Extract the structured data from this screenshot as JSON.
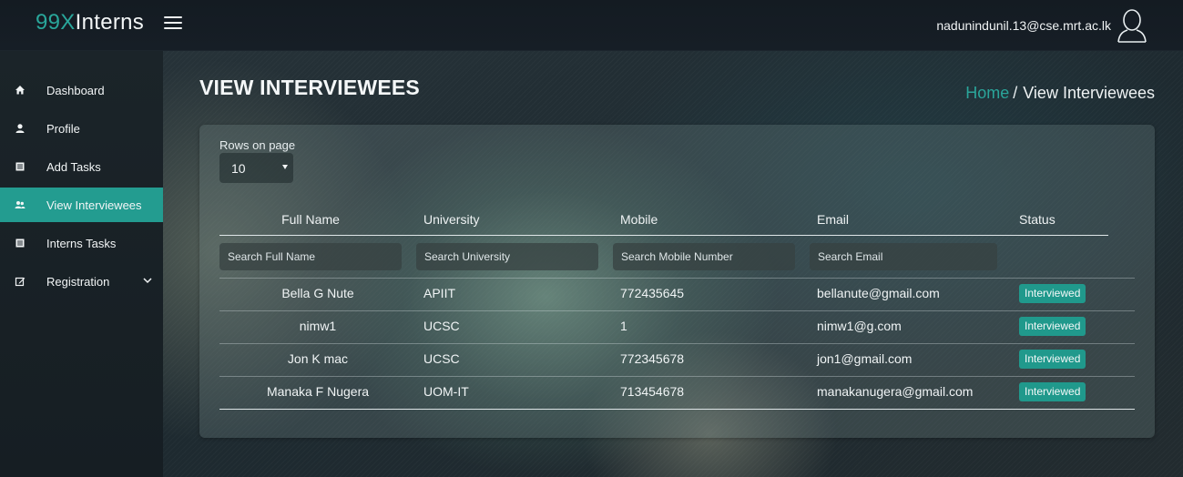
{
  "brand": {
    "accent": "99X",
    "rest": "Interns"
  },
  "user": {
    "email": "nadunindunil.13@cse.mrt.ac.lk"
  },
  "sidebar": {
    "items": [
      {
        "label": "Dashboard",
        "icon": "home-icon"
      },
      {
        "label": "Profile",
        "icon": "user-icon"
      },
      {
        "label": "Add Tasks",
        "icon": "list-icon"
      },
      {
        "label": "View Interviewees",
        "icon": "users-icon",
        "active": true
      },
      {
        "label": "Interns Tasks",
        "icon": "list-icon"
      },
      {
        "label": "Registration",
        "icon": "edit-icon",
        "has_submenu": true
      }
    ]
  },
  "page": {
    "title": "VIEW INTERVIEWEES",
    "breadcrumb": {
      "home": "Home",
      "separator": "/",
      "current": "View Interviewees"
    }
  },
  "table": {
    "rows_label": "Rows on page",
    "rows_value": "10",
    "columns": [
      "Full Name",
      "University",
      "Mobile",
      "Email",
      "Status"
    ],
    "search": {
      "full_name": "Search Full Name",
      "university": "Search University",
      "mobile": "Search Mobile Number",
      "email": "Search Email"
    },
    "rows": [
      {
        "name": "Bella G Nute",
        "university": "APIIT",
        "mobile": "772435645",
        "email": "bellanute@gmail.com",
        "status": "Interviewed"
      },
      {
        "name": "nimw1",
        "university": "UCSC",
        "mobile": "1",
        "email": "nimw1@g.com",
        "status": "Interviewed"
      },
      {
        "name": "Jon K mac",
        "university": "UCSC",
        "mobile": "772345678",
        "email": "jon1@gmail.com",
        "status": "Interviewed"
      },
      {
        "name": "Manaka F Nugera",
        "university": "UOM-IT",
        "mobile": "713454678",
        "email": "manakanugera@gmail.com",
        "status": "Interviewed"
      }
    ]
  },
  "colors": {
    "accent": "#29a69a",
    "active_nav": "#239c90",
    "badge": "#20998c"
  }
}
